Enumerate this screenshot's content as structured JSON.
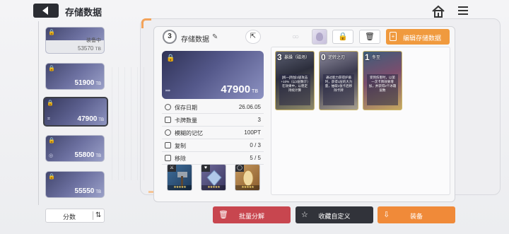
{
  "header": {
    "title": "存储数据",
    "back_icon": "back-arrow-icon",
    "home_icon": "home-icon",
    "menu_icon": "menu-icon"
  },
  "slots": [
    {
      "value": "53570",
      "unit": "TB",
      "status": "装备中"
    },
    {
      "value": "51900",
      "unit": "TB"
    },
    {
      "value": "47900",
      "unit": "TB"
    },
    {
      "value": "55800",
      "unit": "TB"
    },
    {
      "value": "55550",
      "unit": "TB"
    }
  ],
  "sort": {
    "label": "分数",
    "order_icon": "sort-order-icon"
  },
  "detail": {
    "count": "3",
    "title": "存储数据",
    "big_value": "47900",
    "big_unit": "TB",
    "stats": [
      {
        "icon": "clock-icon",
        "label": "保存日期",
        "value": "26.06.05"
      },
      {
        "icon": "card-icon",
        "label": "卡牌数量",
        "value": "3"
      },
      {
        "icon": "memory-icon",
        "label": "模糊的记忆",
        "value": "100PT"
      },
      {
        "icon": "copy-icon",
        "label": "复制",
        "value": "0 / 3"
      },
      {
        "icon": "remove-icon",
        "label": "移除",
        "value": "5 / 5"
      }
    ]
  },
  "toolbar": {
    "edit_data_label": "编辑存储数据"
  },
  "cards": [
    {
      "cost": "3",
      "name": "暴躁（磁场）",
      "desc": "[统一]附加1级攻击+10%（以3层数计）在效果中，以稳定持续计算"
    },
    {
      "cost": "0",
      "name": "逆转之刃",
      "desc": "通过能力获得护盾时，获得1层的大力量，抽取1张卡后移除卡牌"
    },
    {
      "cost": "1",
      "name": "冬至",
      "desc": "受到伤害时，以第一次卡牌效果增加，并获得2个冰霜层数"
    }
  ],
  "buttons": {
    "dismantle": "批量分解",
    "custom": "收藏自定义",
    "equip": "装备"
  },
  "colors": {
    "accent_orange": "#f09a3e",
    "danger_red": "#c8464f",
    "dark": "#31333a"
  }
}
